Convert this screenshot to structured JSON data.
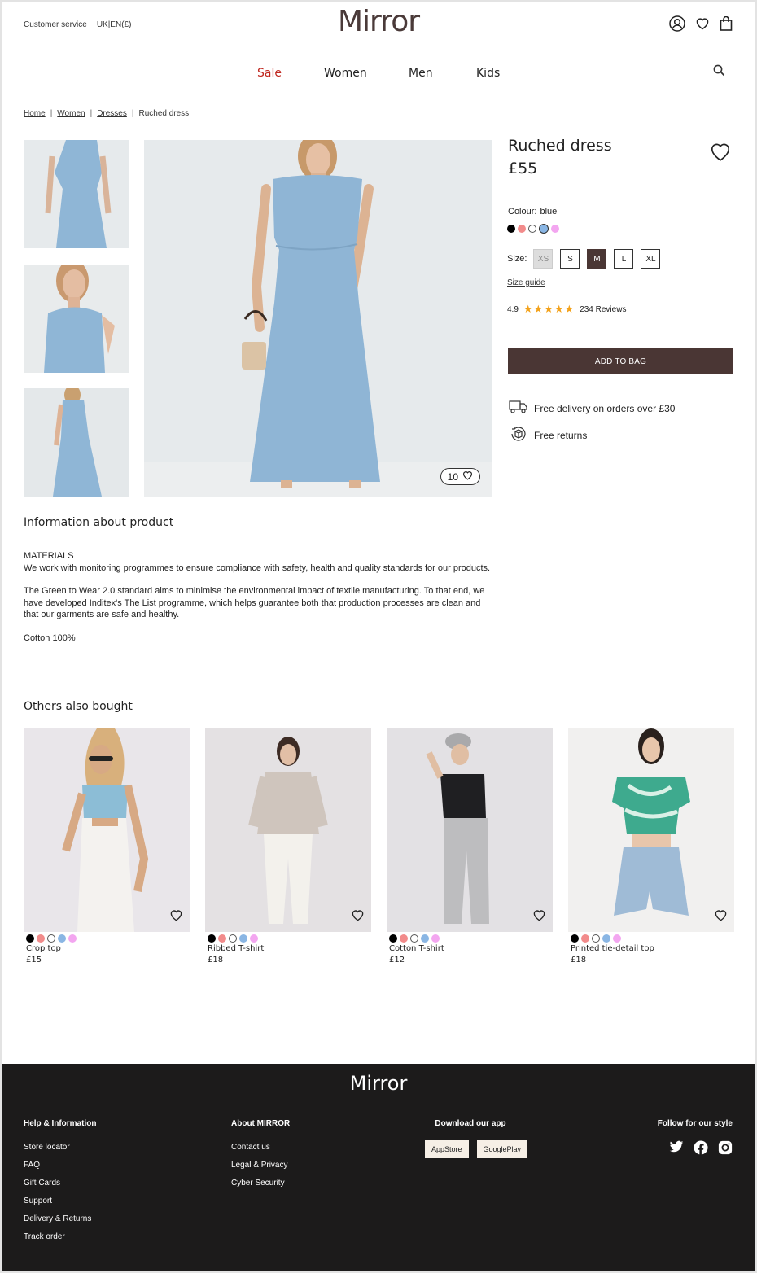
{
  "header": {
    "customer_service": "Customer service",
    "locale": "UK|EN(£)",
    "logo": "Mirror",
    "nav": [
      {
        "label": "Sale",
        "color": "#c0271f"
      },
      {
        "label": "Women",
        "color": "#222222"
      },
      {
        "label": "Men",
        "color": "#222222"
      },
      {
        "label": "Kids",
        "color": "#222222"
      }
    ],
    "search_placeholder": ""
  },
  "breadcrumb": [
    "Home",
    "Women",
    "Dresses",
    "Ruched dress"
  ],
  "product": {
    "title": "Ruched dress",
    "price": "£55",
    "colour_label": "Colour:",
    "colour_value": "blue",
    "swatches": [
      "#000000",
      "#f28b8b",
      "#ffffff",
      "#8ab6e4",
      "#f3a6f0"
    ],
    "selected_swatch": 3,
    "size_label": "Size:",
    "sizes": [
      {
        "label": "XS",
        "state": "disabled"
      },
      {
        "label": "S",
        "state": "normal"
      },
      {
        "label": "M",
        "state": "selected"
      },
      {
        "label": "L",
        "state": "normal"
      },
      {
        "label": "XL",
        "state": "normal"
      }
    ],
    "size_guide": "Size guide",
    "rating": "4.9",
    "stars": "★★★★★",
    "reviews": "234 Reviews",
    "add_to_bag": "ADD TO BAG",
    "likes": "10",
    "perks": [
      "Free delivery on orders over £30",
      "Free returns"
    ],
    "brand_color": "#4a3634"
  },
  "info": {
    "heading": "Information about product",
    "paragraphs": [
      "MATERIALS",
      "We work with monitoring programmes to ensure compliance with safety, health and quality standards for our products.",
      "The Green to Wear 2.0 standard aims to minimise the environmental impact of textile manufacturing. To that end, we have developed Inditex's The List programme, which helps guarantee both that production processes are clean and that our garments are safe and healthy.",
      "Cotton 100%"
    ]
  },
  "others": {
    "heading": "Others also bought",
    "items": [
      {
        "name": "Crop top",
        "price": "£15"
      },
      {
        "name": "Ribbed T-shirt",
        "price": "£18"
      },
      {
        "name": "Cotton T-shirt",
        "price": "£12"
      },
      {
        "name": "Printed tie-detail top",
        "price": "£18"
      }
    ]
  },
  "footer": {
    "logo": "Mirror",
    "help": {
      "title": "Help & Information",
      "links": [
        "Store locator",
        "FAQ",
        "Gift Cards",
        "Support",
        "Delivery & Returns",
        "Track order"
      ]
    },
    "about": {
      "title": "About MIRROR",
      "links": [
        "Contact us",
        "Legal & Privacy",
        "Cyber Security"
      ]
    },
    "app": {
      "title": "Download our app",
      "buttons": [
        "AppStore",
        "GooglePlay"
      ]
    },
    "social": {
      "title": "Follow for our style",
      "icons": [
        "twitter-icon",
        "facebook-icon",
        "instagram-icon"
      ]
    }
  }
}
